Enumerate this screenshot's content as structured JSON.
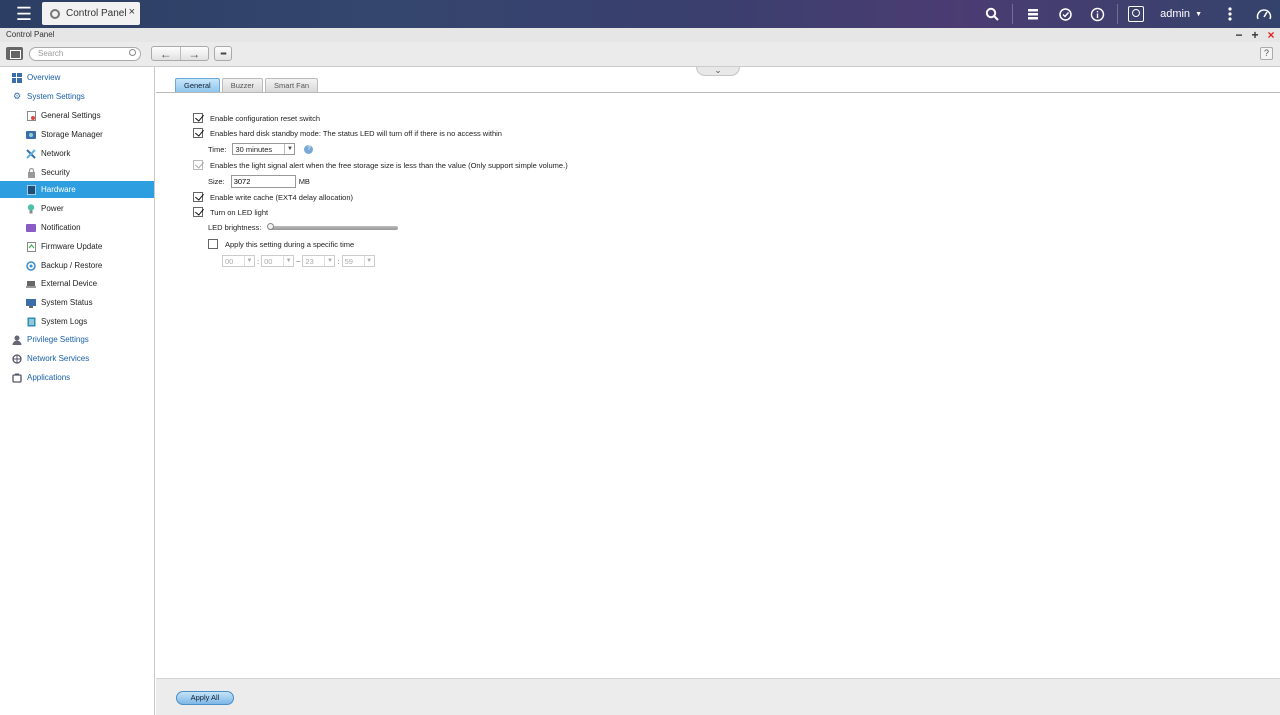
{
  "topbar": {
    "menu_icon": "hamburger-icon",
    "app_tab_label": "Control Panel",
    "app_tab_close": "×",
    "username": "admin",
    "icons": [
      "search-icon",
      "storage-stack-icon",
      "sync-icon",
      "info-icon",
      "user-icon",
      "more-vertical-icon",
      "dashboard-gauge-icon"
    ]
  },
  "window": {
    "title": "Control Panel",
    "minimize": "−",
    "maximize": "+",
    "close": "×"
  },
  "toolbar": {
    "search_placeholder": "Search",
    "back": "←",
    "forward": "→",
    "grid": "▪▪▪",
    "help": "?"
  },
  "sidebar": {
    "items": [
      {
        "label": "Overview",
        "level": 0,
        "icon": "overview-icon"
      },
      {
        "label": "System Settings",
        "level": 0,
        "icon": "gear-icon"
      },
      {
        "label": "General Settings",
        "level": 1,
        "icon": "general-settings-icon"
      },
      {
        "label": "Storage Manager",
        "level": 1,
        "icon": "storage-icon"
      },
      {
        "label": "Network",
        "level": 1,
        "icon": "network-icon"
      },
      {
        "label": "Security",
        "level": 1,
        "icon": "lock-icon"
      },
      {
        "label": "Hardware",
        "level": 1,
        "icon": "hardware-icon",
        "active": true
      },
      {
        "label": "Power",
        "level": 1,
        "icon": "power-bulb-icon"
      },
      {
        "label": "Notification",
        "level": 1,
        "icon": "notification-icon"
      },
      {
        "label": "Firmware Update",
        "level": 1,
        "icon": "firmware-icon"
      },
      {
        "label": "Backup / Restore",
        "level": 1,
        "icon": "backup-icon"
      },
      {
        "label": "External Device",
        "level": 1,
        "icon": "external-device-icon"
      },
      {
        "label": "System Status",
        "level": 1,
        "icon": "system-status-icon"
      },
      {
        "label": "System Logs",
        "level": 1,
        "icon": "system-logs-icon"
      },
      {
        "label": "Privilege Settings",
        "level": 0,
        "icon": "privilege-user-icon"
      },
      {
        "label": "Network Services",
        "level": 0,
        "icon": "network-services-icon"
      },
      {
        "label": "Applications",
        "level": 0,
        "icon": "applications-icon"
      }
    ]
  },
  "content": {
    "collapse_icon": "⌄",
    "tabs": [
      {
        "label": "General",
        "active": true
      },
      {
        "label": "Buzzer",
        "active": false
      },
      {
        "label": "Smart Fan",
        "active": false
      }
    ],
    "settings": {
      "reset_switch_label": "Enable configuration reset switch",
      "reset_switch_checked": true,
      "standby_label": "Enables hard disk standby mode: The status LED will turn off if there is no access within",
      "standby_checked": true,
      "time_label": "Time:",
      "time_value": "30 minutes",
      "time_help": "?",
      "light_alert_label": "Enables the light signal alert when the free storage size is less than the value (Only support simple volume.)",
      "light_alert_checked": true,
      "size_label": "Size:",
      "size_value": "3072",
      "size_unit": "MB",
      "write_cache_label": "Enable write cache (EXT4 delay allocation)",
      "write_cache_checked": true,
      "led_light_label": "Turn on LED light",
      "led_light_checked": true,
      "led_brightness_label": "LED brightness:",
      "led_brightness_level": 0,
      "specific_time_label": "Apply this setting during a specific time",
      "specific_time_checked": false,
      "start_hour": "00",
      "start_minute": "00",
      "end_hour": "23",
      "end_minute": "59",
      "time_colon": ":",
      "range_sep": "~"
    }
  },
  "bottombar": {
    "apply_all_label": "Apply All"
  }
}
